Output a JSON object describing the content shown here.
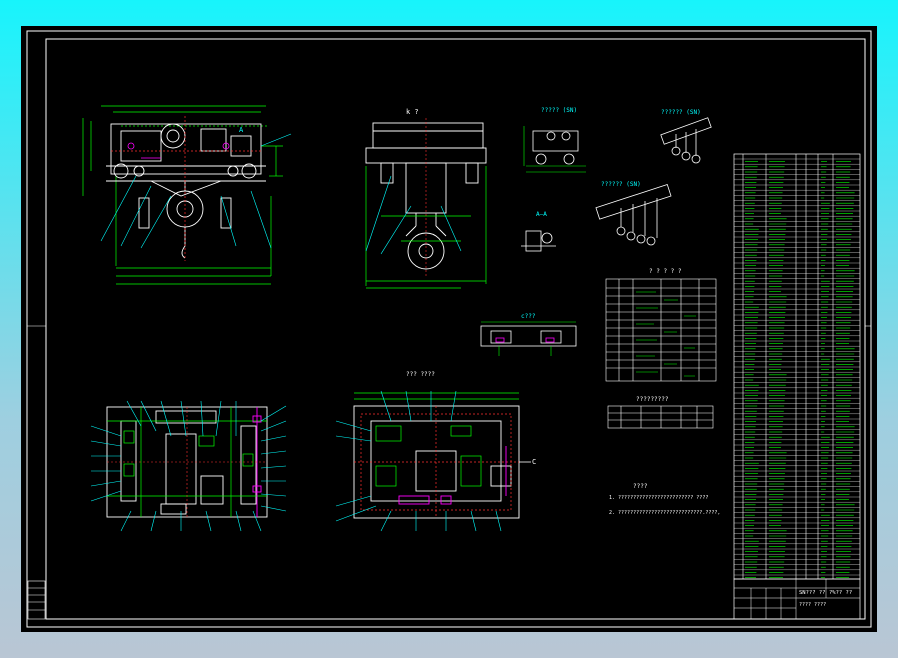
{
  "views": {
    "side_view_label": "A",
    "front_view_title": "k ?",
    "section_title_1": "????? (SN)",
    "section_title_2": "?????? (SN)",
    "section_title_3": "?????? (SN)",
    "section_aa": "A—A",
    "detail_title": "c???",
    "plan_view_title": "??? ????",
    "table_title": "? ? ? ? ?",
    "subtable_title": "?????????",
    "notes_title": "????",
    "note_1": "1. ????????????????????????? ????",
    "note_2": "2. ????????????????????????????.????,",
    "arrow_c": "C"
  },
  "title_block": {
    "drawing_name": "SN??? ??",
    "sheet_label": "?%?? ??",
    "company": "???? ????"
  },
  "colors": {
    "background": "#000000",
    "frame": "#ffffff",
    "structure": "#ffffff",
    "dimensions": "#00ff00",
    "leaders": "#00ffff",
    "hidden": "#ff3030",
    "accent": "#ff00ff",
    "text": "#ffff00",
    "table_lines": "#ffffff",
    "table_text": "#00ff00"
  }
}
